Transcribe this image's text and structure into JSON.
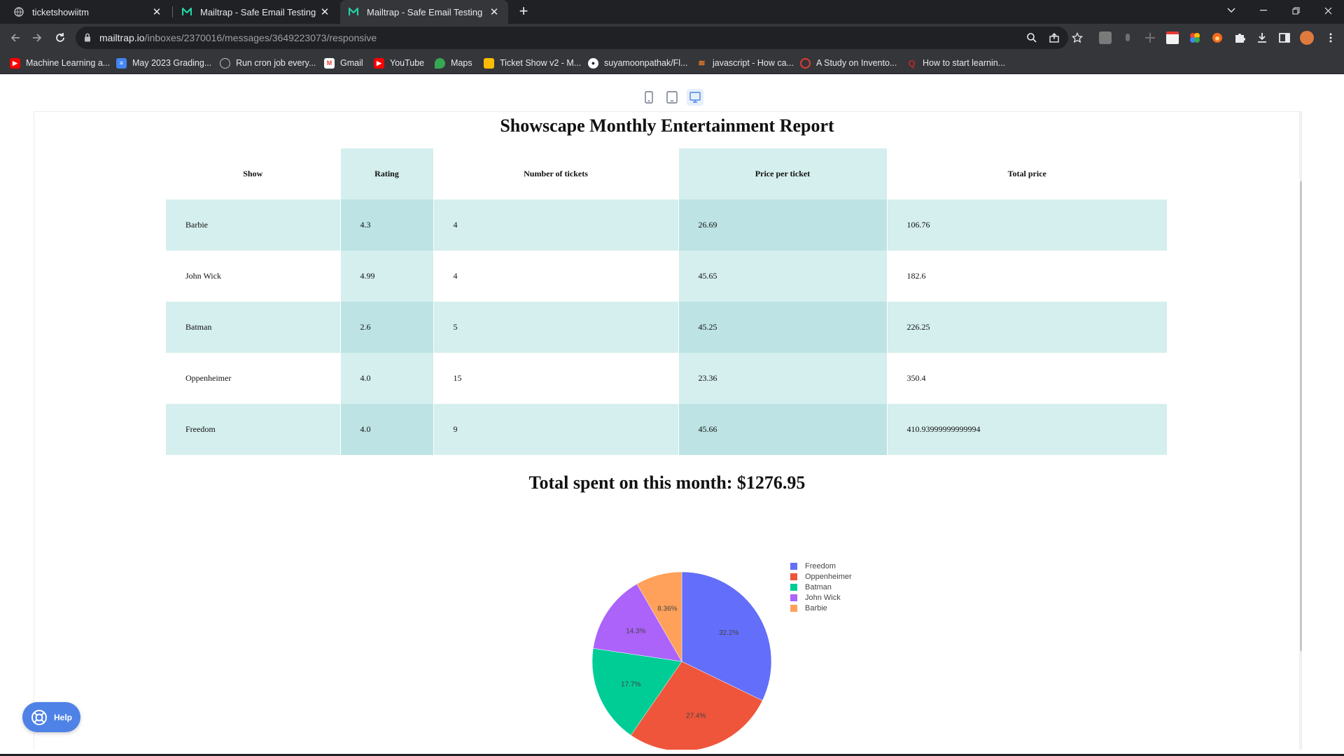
{
  "tabs": [
    {
      "title": "ticketshowiitm",
      "icon": "globe-icon"
    },
    {
      "title": "Mailtrap - Safe Email Testing",
      "icon": "mailtrap-icon"
    },
    {
      "title": "Mailtrap - Safe Email Testing",
      "icon": "mailtrap-icon",
      "active": true
    }
  ],
  "address_bar": {
    "host": "mailtrap.io",
    "path": "/inboxes/2370016/messages/3649223073/responsive"
  },
  "bookmarks": [
    {
      "label": "Machine Learning a...",
      "icon": "youtube-icon",
      "color": "#ff0000"
    },
    {
      "label": "May 2023 Grading...",
      "icon": "docs-icon",
      "color": "#4285f4"
    },
    {
      "label": "Run cron job every...",
      "icon": "globe-icon",
      "color": "#9aa0a6"
    },
    {
      "label": "Gmail",
      "icon": "gmail-icon",
      "color": "#ea4335"
    },
    {
      "label": "YouTube",
      "icon": "youtube-icon",
      "color": "#ff0000"
    },
    {
      "label": "Maps",
      "icon": "maps-icon",
      "color": "#34a853"
    },
    {
      "label": "Ticket Show v2 - M...",
      "icon": "slides-icon",
      "color": "#fbbc04"
    },
    {
      "label": "suyamoonpathak/Fl...",
      "icon": "github-icon",
      "color": "#ffffff"
    },
    {
      "label": "javascript - How ca...",
      "icon": "stackoverflow-icon",
      "color": "#f48024"
    },
    {
      "label": "A Study on Invento...",
      "icon": "target-icon",
      "color": "#e53935"
    },
    {
      "label": "How to start learnin...",
      "icon": "quora-icon",
      "color": "#b92b27"
    }
  ],
  "report": {
    "title": "Showscape Monthly Entertainment Report",
    "columns": [
      "Show",
      "Rating",
      "Number of tickets",
      "Price per ticket",
      "Total price"
    ],
    "rows": [
      [
        "Barbie",
        "4.3",
        "4",
        "26.69",
        "106.76"
      ],
      [
        "John Wick",
        "4.99",
        "4",
        "45.65",
        "182.6"
      ],
      [
        "Batman",
        "2.6",
        "5",
        "45.25",
        "226.25"
      ],
      [
        "Oppenheimer",
        "4.0",
        "15",
        "23.36",
        "350.4"
      ],
      [
        "Freedom",
        "4.0",
        "9",
        "45.66",
        "410.93999999999994"
      ]
    ],
    "total_text": "Total spent on this month: $1276.95"
  },
  "chart_data": {
    "type": "pie",
    "labels": [
      "Freedom",
      "Oppenheimer",
      "Batman",
      "John Wick",
      "Barbie"
    ],
    "values": [
      410.94,
      350.4,
      226.25,
      182.6,
      106.76
    ],
    "percent_labels": [
      "32.2%",
      "27.4%",
      "17.7%",
      "14.3%",
      "8.36%"
    ],
    "colors": [
      "#636efa",
      "#ef553b",
      "#00cc96",
      "#ab63fa",
      "#ffa15a"
    ],
    "legend_position": "right"
  },
  "help_button": {
    "label": "Help"
  }
}
